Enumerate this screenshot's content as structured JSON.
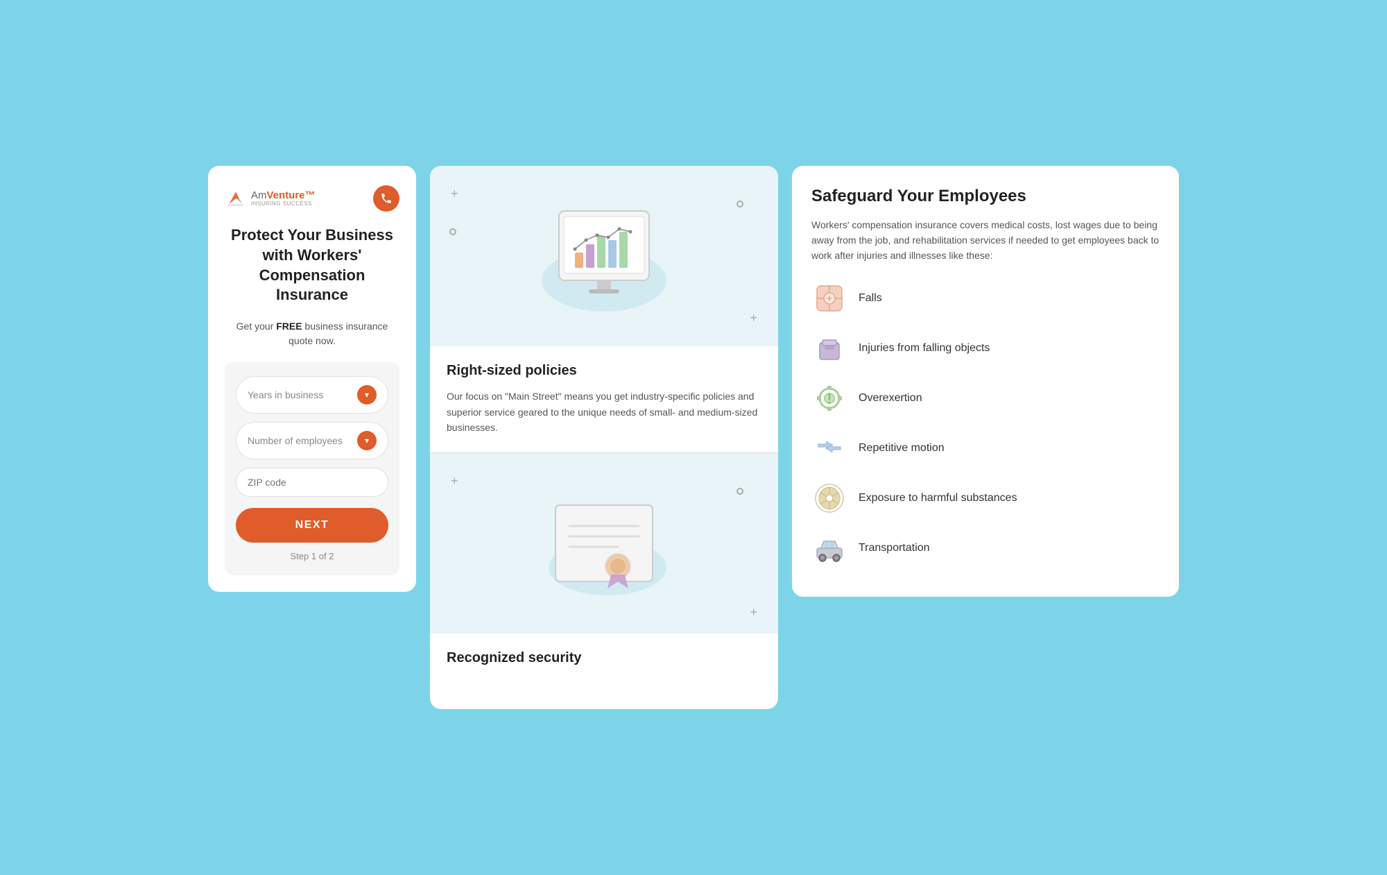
{
  "card1": {
    "logo": {
      "name": "Am",
      "name_suffix": "Venture™",
      "tagline": "INSURING SUCCESS"
    },
    "title": "Protect Your Business with Workers' Compensation Insurance",
    "quote_text_plain": "Get your ",
    "quote_bold": "FREE",
    "quote_text_after": " business insurance quote now.",
    "years_label": "Years in business",
    "employees_label": "Number of employees",
    "zip_placeholder": "ZIP code",
    "next_label": "NEXT",
    "step_label": "Step 1 of 2"
  },
  "card2": {
    "section1": {
      "title": "Right-sized policies",
      "text": "Our focus on \"Main Street\" means you get industry-specific policies and superior service geared to the unique needs of small- and medium-sized businesses."
    },
    "section2": {
      "title": "Recognized security"
    }
  },
  "card3": {
    "title": "Safeguard Your Employees",
    "description": "Workers' compensation insurance covers medical costs, lost wages due to being away from the job, and rehabilitation services if needed to get employees back to work after injuries and illnesses like these:",
    "injuries": [
      {
        "label": "Falls",
        "icon": "bandage"
      },
      {
        "label": "Injuries from falling objects",
        "icon": "box"
      },
      {
        "label": "Overexertion",
        "icon": "gear"
      },
      {
        "label": "Repetitive motion",
        "icon": "arrows"
      },
      {
        "label": "Exposure to harmful substances",
        "icon": "radiation"
      },
      {
        "label": "Transportation",
        "icon": "car"
      }
    ]
  }
}
